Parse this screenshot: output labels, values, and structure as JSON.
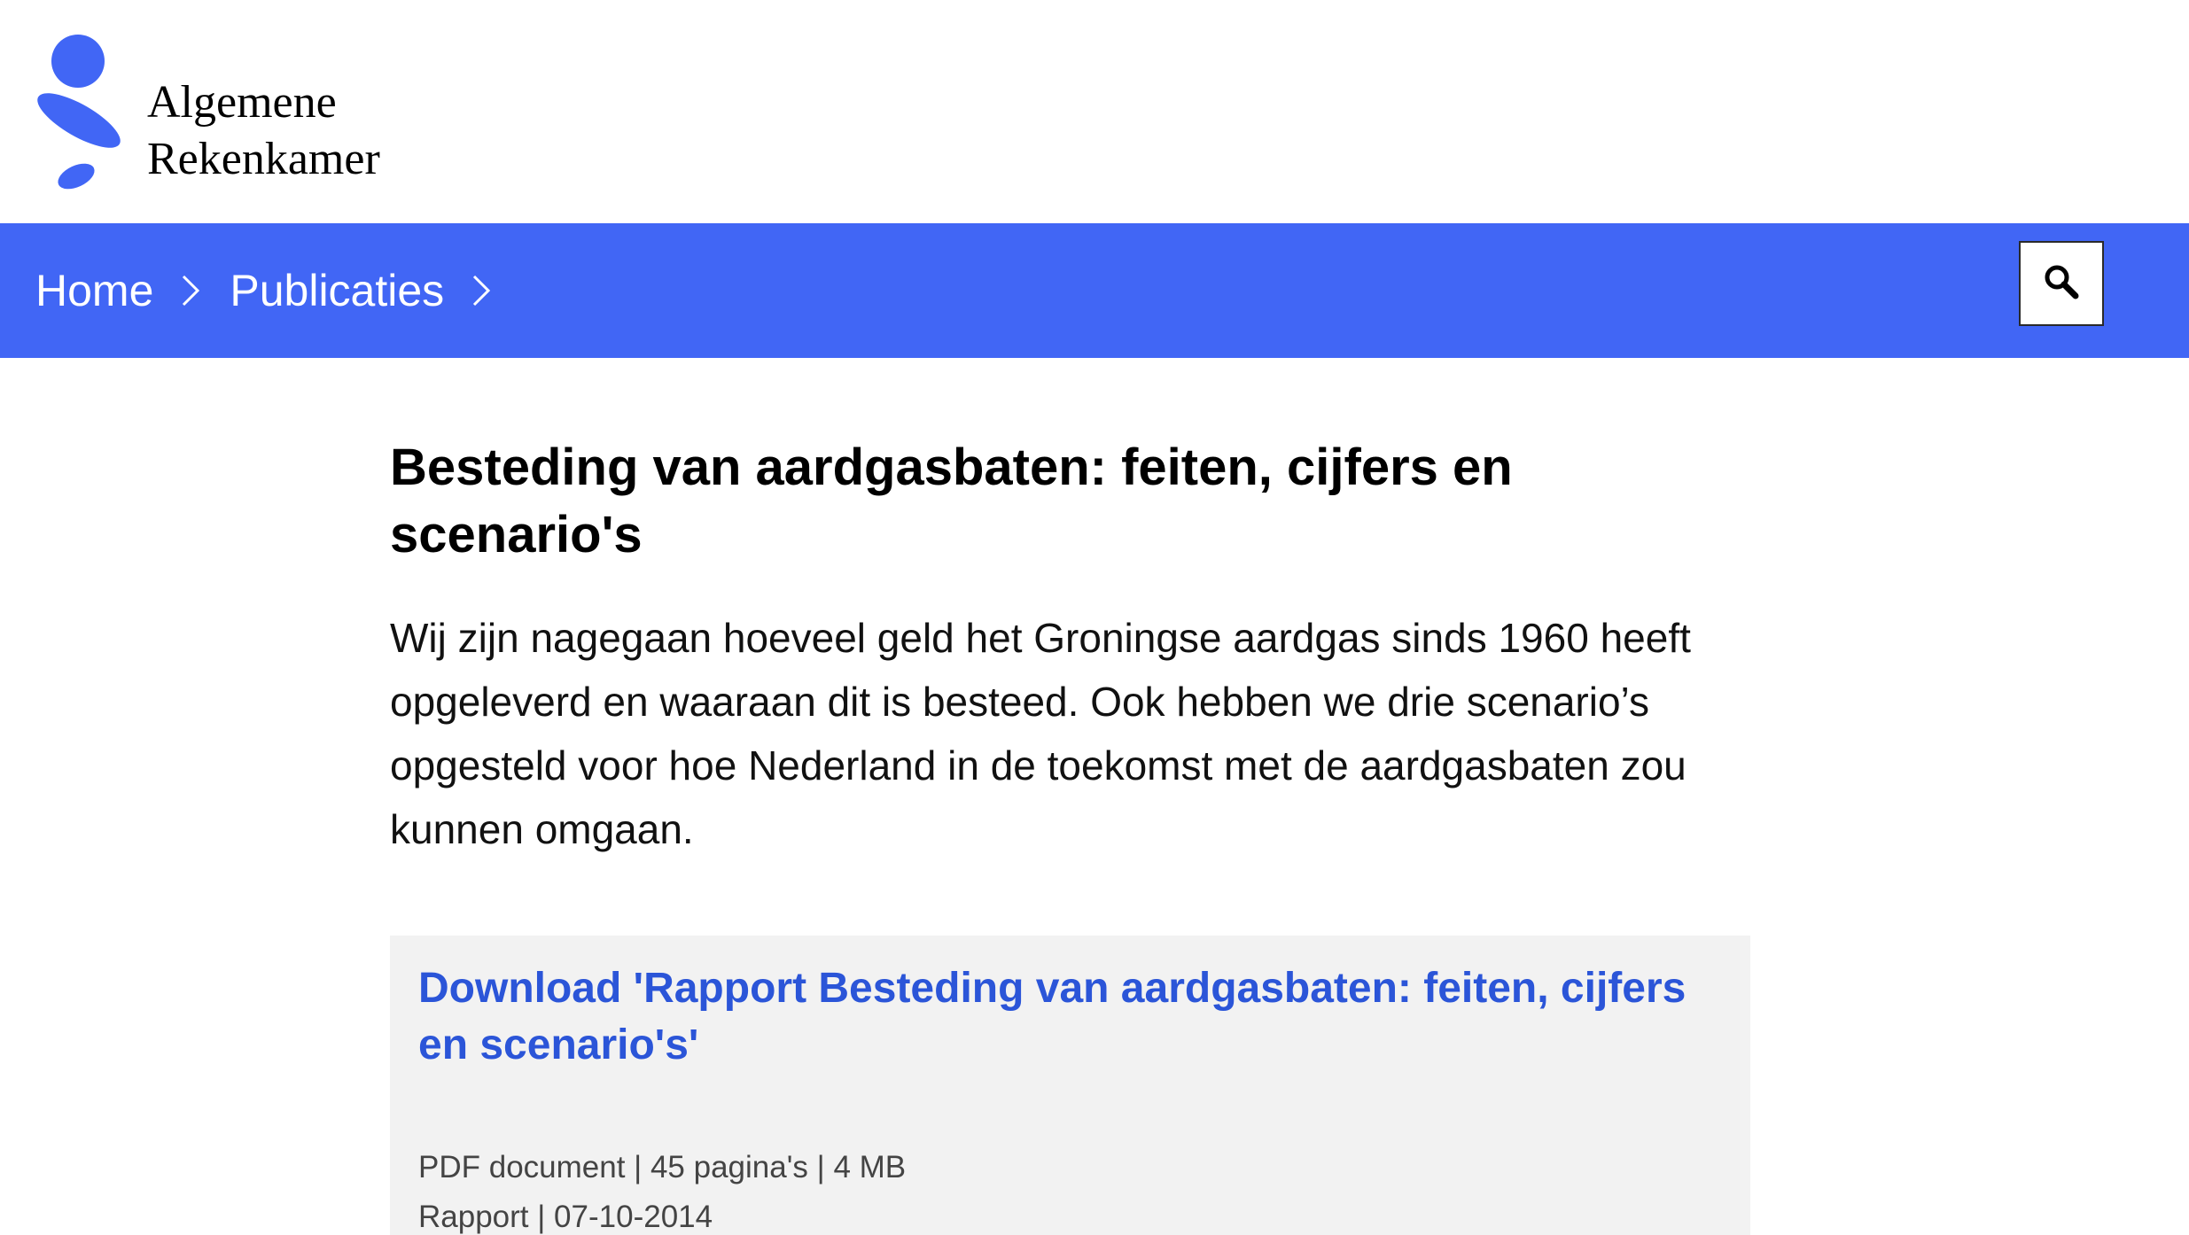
{
  "logo": {
    "line1": "Algemene",
    "line2": "Rekenkamer"
  },
  "breadcrumb": {
    "items": [
      {
        "label": "Home"
      },
      {
        "label": "Publicaties"
      }
    ]
  },
  "search": {
    "icon": "search-icon"
  },
  "article": {
    "title": "Besteding van aardgasbaten: feiten, cijfers en scenario's",
    "intro": "Wij zijn nagegaan hoeveel geld het Groningse aardgas sinds 1960 heeft opgeleverd en waaraan dit is besteed. Ook hebben we drie scenario’s opgesteld voor hoe Nederland in de toekomst met de aardgasbaten zou kunnen omgaan."
  },
  "download": {
    "label": "Download 'Rapport Besteding van aardgasbaten: feiten, cijfers en scenario's'",
    "meta_line1": "PDF document | 45 pagina's | 4 MB",
    "meta_line2": "Rapport | 07-10-2014"
  },
  "colors": {
    "brand_blue": "#4166f5",
    "link_blue": "#2b55d8",
    "card_bg": "#f2f2f2"
  }
}
